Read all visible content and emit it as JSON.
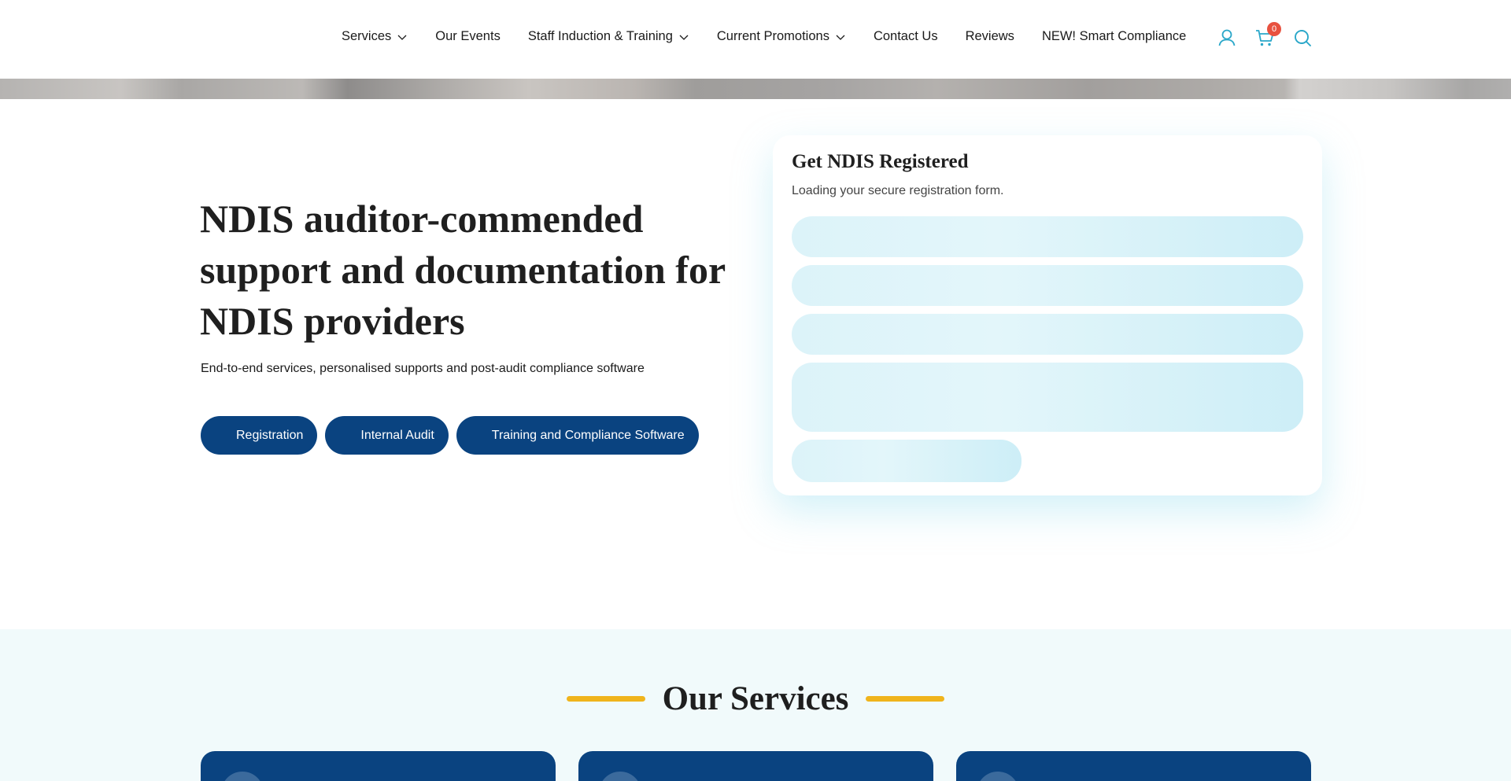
{
  "nav": {
    "items": [
      {
        "label": "Services",
        "dropdown": true
      },
      {
        "label": "Our Events",
        "dropdown": false
      },
      {
        "label": "Staff Induction & Training",
        "dropdown": true
      },
      {
        "label": "Current Promotions",
        "dropdown": true
      },
      {
        "label": "Contact Us",
        "dropdown": false
      },
      {
        "label": "Reviews",
        "dropdown": false
      },
      {
        "label": "NEW! Smart Compliance",
        "dropdown": false
      }
    ],
    "icons": {
      "account": "user-icon",
      "cart": "cart-icon",
      "search": "search-icon"
    },
    "cart_count": "0"
  },
  "hero": {
    "title": "NDIS auditor-commended support and documentation for NDIS providers",
    "subtitle": "End-to-end services, personalised supports and post-audit compliance software",
    "buttons": [
      {
        "label": "Registration"
      },
      {
        "label": "Internal Audit"
      },
      {
        "label": "Training and Compliance Software"
      }
    ]
  },
  "registration_card": {
    "title": "Get NDIS Registered",
    "loading_text": "Loading your secure registration form."
  },
  "services": {
    "title": "Our Services"
  },
  "colors": {
    "primary_navy": "#0a4380",
    "accent_teal": "#2aa7c9",
    "accent_yellow": "#f0b41c",
    "badge_red": "#e8513f"
  }
}
